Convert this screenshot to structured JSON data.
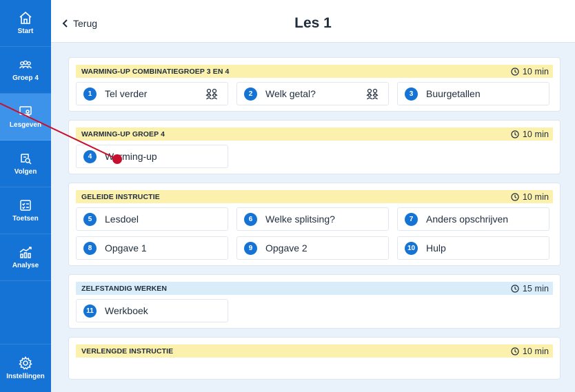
{
  "sidebar": {
    "items": [
      {
        "label": "Start",
        "icon": "home-icon"
      },
      {
        "label": "Groep 4",
        "icon": "group-icon"
      },
      {
        "label": "Lesgeven",
        "icon": "presentation-icon",
        "active": true
      },
      {
        "label": "Volgen",
        "icon": "track-icon"
      },
      {
        "label": "Toetsen",
        "icon": "checklist-icon"
      },
      {
        "label": "Analyse",
        "icon": "chart-icon"
      }
    ],
    "settings": {
      "label": "Instellingen",
      "icon": "gear-icon"
    }
  },
  "header": {
    "back_label": "Terug",
    "title": "Les 1"
  },
  "sections": [
    {
      "title": "WARMING-UP COMBINATIEGROEP 3 EN 4",
      "duration": "10 min",
      "color": "#fbf1ad",
      "activities": [
        {
          "num": "1",
          "label": "Tel verder",
          "group_icon": true
        },
        {
          "num": "2",
          "label": "Welk getal?",
          "group_icon": true
        },
        {
          "num": "3",
          "label": "Buurgetallen",
          "group_icon": false
        }
      ]
    },
    {
      "title": "WARMING-UP GROEP 4",
      "duration": "10 min",
      "color": "#fbf1ad",
      "activities": [
        {
          "num": "4",
          "label": "Warming-up",
          "group_icon": false
        }
      ]
    },
    {
      "title": "GELEIDE INSTRUCTIE",
      "duration": "10 min",
      "color": "#fbf1ad",
      "activities": [
        {
          "num": "5",
          "label": "Lesdoel",
          "group_icon": false
        },
        {
          "num": "6",
          "label": "Welke splitsing?",
          "group_icon": false
        },
        {
          "num": "7",
          "label": "Anders opschrijven",
          "group_icon": false
        },
        {
          "num": "8",
          "label": "Opgave 1",
          "group_icon": false
        },
        {
          "num": "9",
          "label": "Opgave 2",
          "group_icon": false
        },
        {
          "num": "10",
          "label": "Hulp",
          "group_icon": false
        }
      ]
    },
    {
      "title": "ZELFSTANDIG WERKEN",
      "duration": "15 min",
      "color": "#d9ecf9",
      "activities": [
        {
          "num": "11",
          "label": "Werkboek",
          "group_icon": false
        }
      ]
    },
    {
      "title": "VERLENGDE INSTRUCTIE",
      "duration": "10 min",
      "color": "#fbf1ad",
      "activities": []
    }
  ],
  "colors": {
    "sidebar": "#1673d6",
    "sidebar_active": "#3d93ea",
    "accent": "#1673d6",
    "annotation": "#c8102e"
  }
}
